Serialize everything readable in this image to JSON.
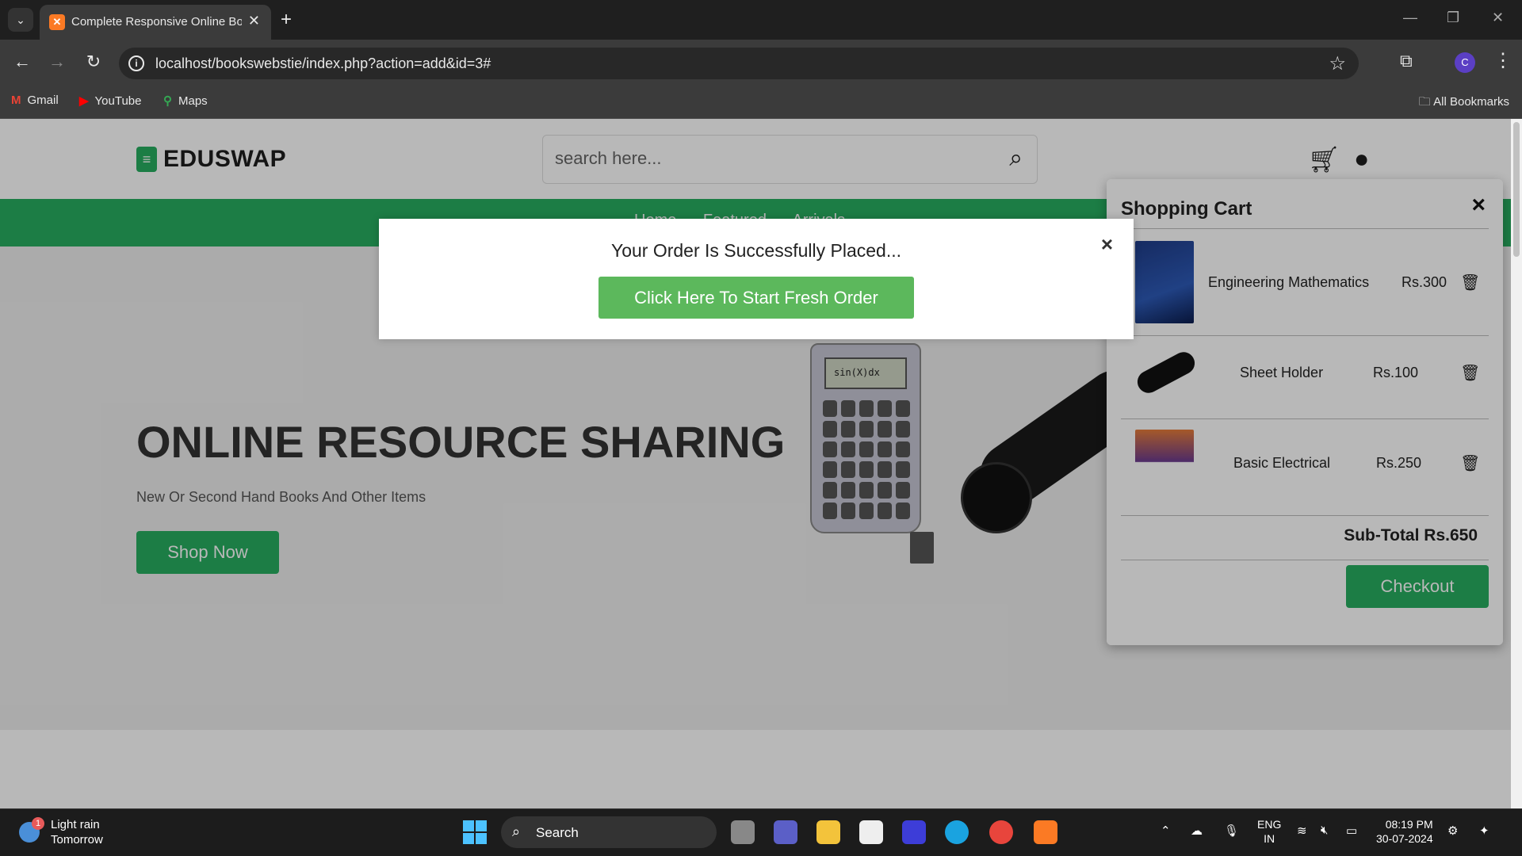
{
  "browser": {
    "tab_title": "Complete Responsive Online Bo",
    "url": "localhost/bookswebstie/index.php?action=add&id=3#",
    "bookmarks": [
      {
        "label": "Gmail",
        "icon": "gmail-icon"
      },
      {
        "label": "YouTube",
        "icon": "youtube-icon"
      },
      {
        "label": "Maps",
        "icon": "maps-icon"
      }
    ],
    "all_bookmarks": "All Bookmarks",
    "profile_initial": "C"
  },
  "site": {
    "logo": "EDUSWAP",
    "search_placeholder": "search here...",
    "nav_links": "Home Featured Arrivals"
  },
  "hero": {
    "title": "ONLINE RESOURCE SHARING",
    "subtitle": "New Or Second Hand Books And Other Items",
    "cta": "Shop Now",
    "calc_display": "sin(X)dx"
  },
  "modal": {
    "message": "Your Order Is Successfully Placed...",
    "button": "Click Here To Start Fresh Order",
    "close": "×"
  },
  "cart": {
    "title": "Shopping Cart",
    "close": "×",
    "items": [
      {
        "name": "Engineering Mathematics",
        "price": "Rs.300"
      },
      {
        "name": "Sheet Holder",
        "price": "Rs.100"
      },
      {
        "name": "Basic Electrical",
        "price": "Rs.250"
      }
    ],
    "subtotal": "Sub-Total Rs.650",
    "checkout": "Checkout"
  },
  "taskbar": {
    "weather_badge": "1",
    "weather_line1": "Light rain",
    "weather_line2": "Tomorrow",
    "search_label": "Search",
    "lang_line1": "ENG",
    "lang_line2": "IN",
    "time": "08:19 PM",
    "date": "30-07-2024"
  },
  "colors": {
    "brand_green": "#27ae60",
    "modal_button": "#5cb85c",
    "chrome_dark": "#1f1f1f"
  }
}
